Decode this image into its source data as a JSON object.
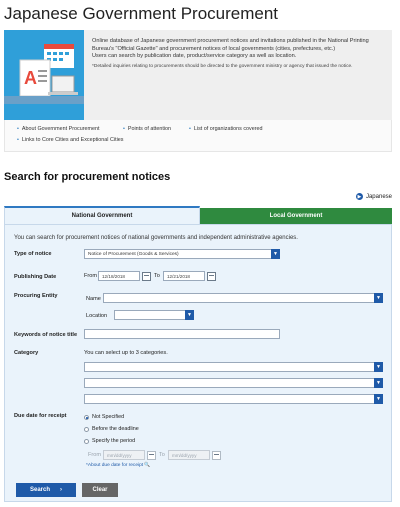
{
  "page": {
    "title": "Japanese Government Procurement"
  },
  "intro": {
    "line1": "Online database of Japanese government procurement notices and invitations published in the National Printing Bureau's \"Official Gazette\" and procurement notices of local governments (cities, prefectures, etc.)",
    "line2": "Users can search by publication date, product/service category as well as location.",
    "note": "*Detailed inquiries relating to procurements should be directed to the government ministry or agency that issued the notice."
  },
  "links": [
    "About Government Procurement",
    "Points of attention",
    "List of organizations covered",
    "Links to Core Cities and Exceptional Cities"
  ],
  "search": {
    "section_title": "Search for procurement notices",
    "language_label": "Japanese",
    "tabs": {
      "national": "National Government",
      "local": "Local Government"
    },
    "description": "You can search for procurement notices of national governments and independent administrative agencies.",
    "type_of_notice": {
      "label": "Type of notice",
      "value": "Notice of Procurement (Goods & Services)"
    },
    "publishing_date": {
      "label": "Publishing Date",
      "from_label": "From",
      "from_value": "12/18/2018",
      "to_label": "To",
      "to_value": "12/21/2018"
    },
    "procuring_entity": {
      "label": "Procuring Entity",
      "name_label": "Name",
      "location_label": "Location"
    },
    "keywords": {
      "label": "Keywords of notice title"
    },
    "category": {
      "label": "Category",
      "hint": "You can select up to 3 categories."
    },
    "due_date": {
      "label": "Due date for receipt",
      "options": [
        "Not Specified",
        "Before the deadline",
        "Specify the period"
      ],
      "selected": "Not Specified",
      "from_label": "From",
      "from_placeholder": "mm/dd/yyyy",
      "to_label": "To",
      "to_placeholder": "mm/dd/yyyy",
      "about_link": "*About due date for receipt"
    },
    "buttons": {
      "search": "Search",
      "clear": "Clear"
    }
  },
  "colors": {
    "accent_blue": "#1f5aa8",
    "local_green": "#2f8a3f",
    "panel_bg": "#eaf3fb",
    "illustration_bg": "#2f9fd9"
  }
}
